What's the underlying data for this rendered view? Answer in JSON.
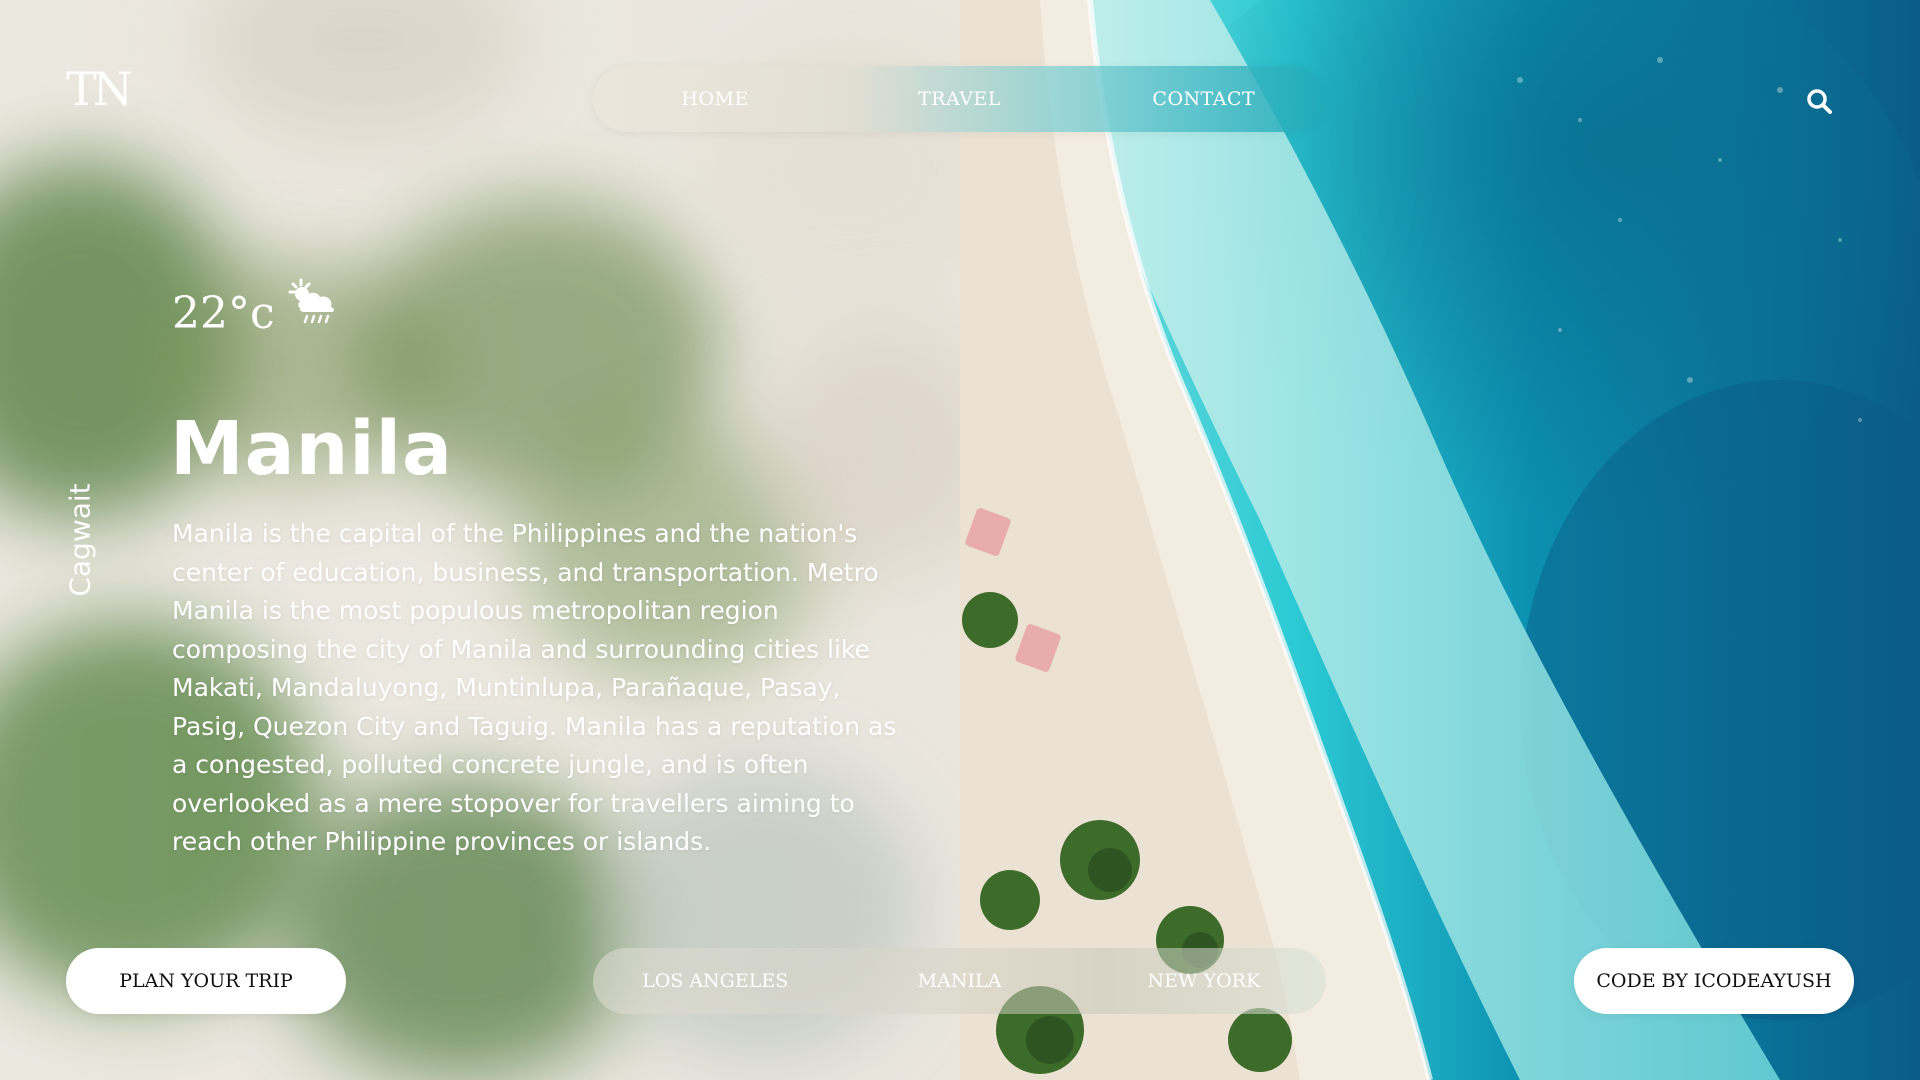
{
  "brand": {
    "logo": "TN"
  },
  "nav": {
    "items": [
      {
        "label": "HOME"
      },
      {
        "label": "TRAVEL"
      },
      {
        "label": "CONTACT"
      }
    ],
    "search_icon": "search-icon"
  },
  "weather": {
    "temperature": "22°c",
    "icon": "sun-cloud-rain-icon"
  },
  "hero": {
    "city": "Manila",
    "description": "Manila is the capital of the Philippines and the nation's center of education, business, and transportation. Metro Manila is the most populous metropolitan region composing the city of Manila and surrounding cities like Makati, Mandaluyong, Muntinlupa, Parañaque, Pasay, Pasig, Quezon City and Taguig. Manila has a reputation as a congested, polluted concrete jungle, and is often overlooked as a mere stopover for travellers aiming to reach other Philippine provinces or islands."
  },
  "side_label": "Cagwait",
  "actions": {
    "plan_label": "PLAN YOUR TRIP",
    "credit_label": "CODE BY ICODEAYUSH"
  },
  "cities": [
    {
      "label": "LOS ANGELES"
    },
    {
      "label": "MANILA"
    },
    {
      "label": "NEW YORK"
    }
  ]
}
